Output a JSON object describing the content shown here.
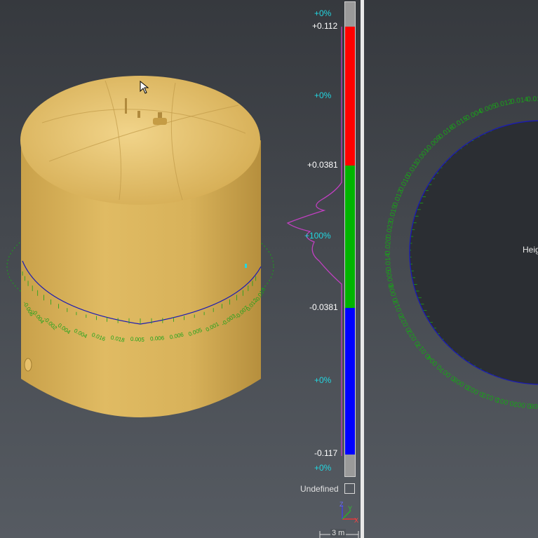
{
  "legend": {
    "labels": [
      {
        "text": "+0%",
        "color": "cyan"
      },
      {
        "text": "+0.112",
        "color": "white"
      },
      {
        "text": "+0%",
        "color": "cyan"
      },
      {
        "text": "+0.0381",
        "color": "white"
      },
      {
        "text": "+100%",
        "color": "cyan"
      },
      {
        "text": "-0.0381",
        "color": "white"
      },
      {
        "text": "+0%",
        "color": "cyan"
      },
      {
        "text": "-0.117",
        "color": "white"
      },
      {
        "text": "+0%",
        "color": "cyan"
      }
    ],
    "segments": [
      {
        "name": "upper-undefined",
        "color": "#9a9a9a"
      },
      {
        "name": "above-tolerance",
        "color": "#ff0000"
      },
      {
        "name": "within-tolerance",
        "color": "#00b400"
      },
      {
        "name": "below-tolerance",
        "color": "#0000ff"
      },
      {
        "name": "lower-undefined",
        "color": "#9a9a9a"
      }
    ],
    "histogram_color": "#c040c0",
    "undefined_label": "Undefined",
    "undefined_checked": false
  },
  "axis_triad": {
    "z": "Z",
    "y": "Y",
    "x": "X"
  },
  "scale_bar": {
    "label": "3 m"
  },
  "left_annotation_labels": [
    "-0.006",
    "-0.004",
    "-0.002",
    "0.004",
    "0.004",
    "0.016",
    "0.018",
    "0.005",
    "0.006",
    "0.006",
    "0.005",
    "0.001",
    "-0.003",
    "-0.007",
    "0.012",
    "-0.016"
  ],
  "right_annotation_labels": [
    "-0.006",
    "0.007",
    "0.010",
    "0.014",
    "0.012",
    "0.005",
    "-0.004",
    "-0.015",
    "-0.016",
    "-0.009",
    "0.001",
    "0.011",
    "0.010",
    "0.012",
    "0.019",
    "0.023",
    "0.020",
    "0.014",
    "0.005",
    "-0.008",
    "-0.013",
    "-0.022",
    "-0.022",
    "-0.017",
    "-0.004",
    "0.007",
    "0.008",
    "0.003",
    "0.010",
    "-0.001",
    "0.002",
    "0.008",
    "0.017"
  ],
  "right_viewport": {
    "label": "Heig"
  },
  "colors": {
    "tank": "#dcb45a",
    "tank_shadow": "#b89140",
    "annotation_green": "#19a319",
    "section_line_blue": "#1a1ab4"
  }
}
